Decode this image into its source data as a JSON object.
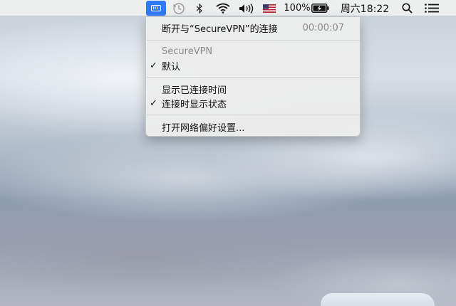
{
  "menubar": {
    "battery_percent": "100%",
    "clock": "周六18:22",
    "icons": {
      "vpn": "securevpn-icon",
      "time_machine": "clock-icon",
      "bluetooth": "bluetooth-icon",
      "wifi": "wifi-icon",
      "volume": "volume-icon",
      "input_source": "us-flag-icon",
      "battery": "battery-charging-icon",
      "spotlight": "search-icon",
      "notification_center": "list-icon"
    }
  },
  "menu": {
    "disconnect_label": "断开与“SecureVPN”的连接",
    "connection_time": "00:00:07",
    "section_header": "SecureVPN",
    "default_label": "默认",
    "default_checked": "✓",
    "show_time_label": "显示已连接时间",
    "show_status_label": "连接时显示状态",
    "show_status_checked": "✓",
    "open_prefs_label": "打开网络偏好设置..."
  },
  "colors": {
    "accent": "#2f7bf6",
    "menu_bg": "#ececec",
    "muted_text": "#8a8a8a"
  }
}
